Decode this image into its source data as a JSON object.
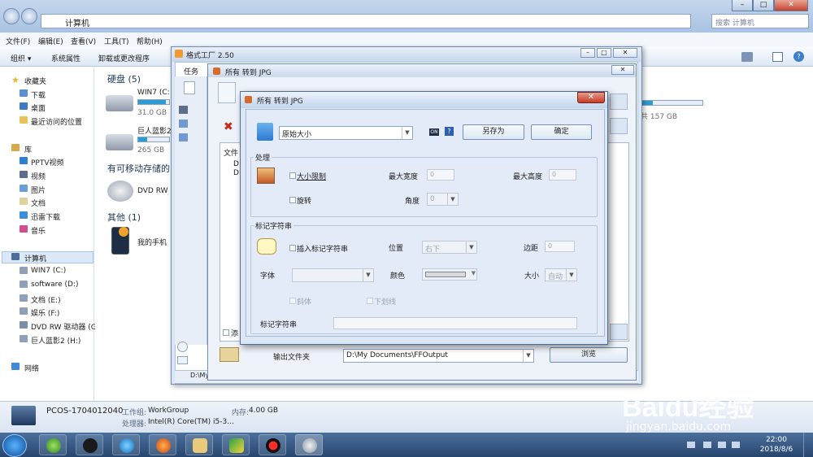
{
  "explorer": {
    "address": "计算机",
    "search_placeholder": "搜索 计算机",
    "menu": [
      "文件(F)",
      "编辑(E)",
      "查看(V)",
      "工具(T)",
      "帮助(H)"
    ],
    "toolbar": [
      "组织 ▾",
      "系统属性",
      "卸载或更改程序"
    ],
    "nav": {
      "favorites_head": "收藏夹",
      "favorites": [
        "下载",
        "桌面",
        "最近访问的位置"
      ],
      "library_head": "库",
      "library": [
        "PPTV视频",
        "视频",
        "图片",
        "文档",
        "迅雷下载",
        "音乐"
      ],
      "computer_head": "计算机",
      "computer": [
        "WIN7 (C:)",
        "software (D:)",
        "文档 (E:)",
        "娱乐 (F:)",
        "DVD RW 驱动器 (G",
        "巨人蓝影2 (H:)"
      ],
      "network": "网络"
    },
    "groups": {
      "hdd": "硬盘 (5)",
      "removable": "有可移动存储的",
      "other": "其他 (1)"
    },
    "drives": [
      {
        "name": "WIN7 (C:",
        "size": "31.0 GB",
        "fill": 0.9
      },
      {
        "name": "巨人蓝影2",
        "size": "265 GB",
        "fill": 0.3
      }
    ],
    "right_drive_size": "共 157 GB",
    "dvd": "DVD RW",
    "phone": "我的手机",
    "details": {
      "computer_name": "PCOS-1704012040",
      "workgroup_label": "工作组:",
      "workgroup": "WorkGroup",
      "memory_label": "内存:",
      "memory": "4.00 GB",
      "cpu_label": "处理器:",
      "cpu": "Intel(R) Core(TM) i5-3..."
    }
  },
  "format_factory": {
    "title": "格式工厂 2.50",
    "task_tab": "任务",
    "file_col": "文件",
    "file_rows": [
      "D",
      "D"
    ],
    "add_label": "添",
    "status_path": "D:\\My Documents\\FFOutput"
  },
  "jpg_outer": {
    "title": "所有 转到 JPG"
  },
  "dialog": {
    "title": "所有 转到 JPG",
    "preset": "原始大小",
    "save_as": "另存为",
    "ok": "确定",
    "processing": {
      "legend": "处理",
      "size_limit": "大小限制",
      "max_width_label": "最大宽度",
      "max_width": "0",
      "max_height_label": "最大高度",
      "max_height": "0",
      "rotate": "旋转",
      "angle_label": "角度",
      "angle": "0"
    },
    "watermark": {
      "legend": "标记字符串",
      "insert": "插入标记字符串",
      "position_label": "位置",
      "position": "右下",
      "margin_label": "边距",
      "margin": "0",
      "font_label": "字体",
      "font": "",
      "color_label": "颜色",
      "size_label": "大小",
      "size": "自动",
      "italic": "斜体",
      "underline": "下划线",
      "string_label": "标记字符串",
      "string": ""
    },
    "output_label": "输出文件夹",
    "output_path": "D:\\My Documents\\FFOutput",
    "browse": "浏览"
  },
  "taskbar": {
    "time": "22:00",
    "date": "2018/8/6"
  },
  "watermark": {
    "brand": "Baidu经验",
    "url": "jingyan.baidu.com"
  },
  "colors": {
    "accent": "#2a9bd3",
    "close": "#c53b25"
  }
}
